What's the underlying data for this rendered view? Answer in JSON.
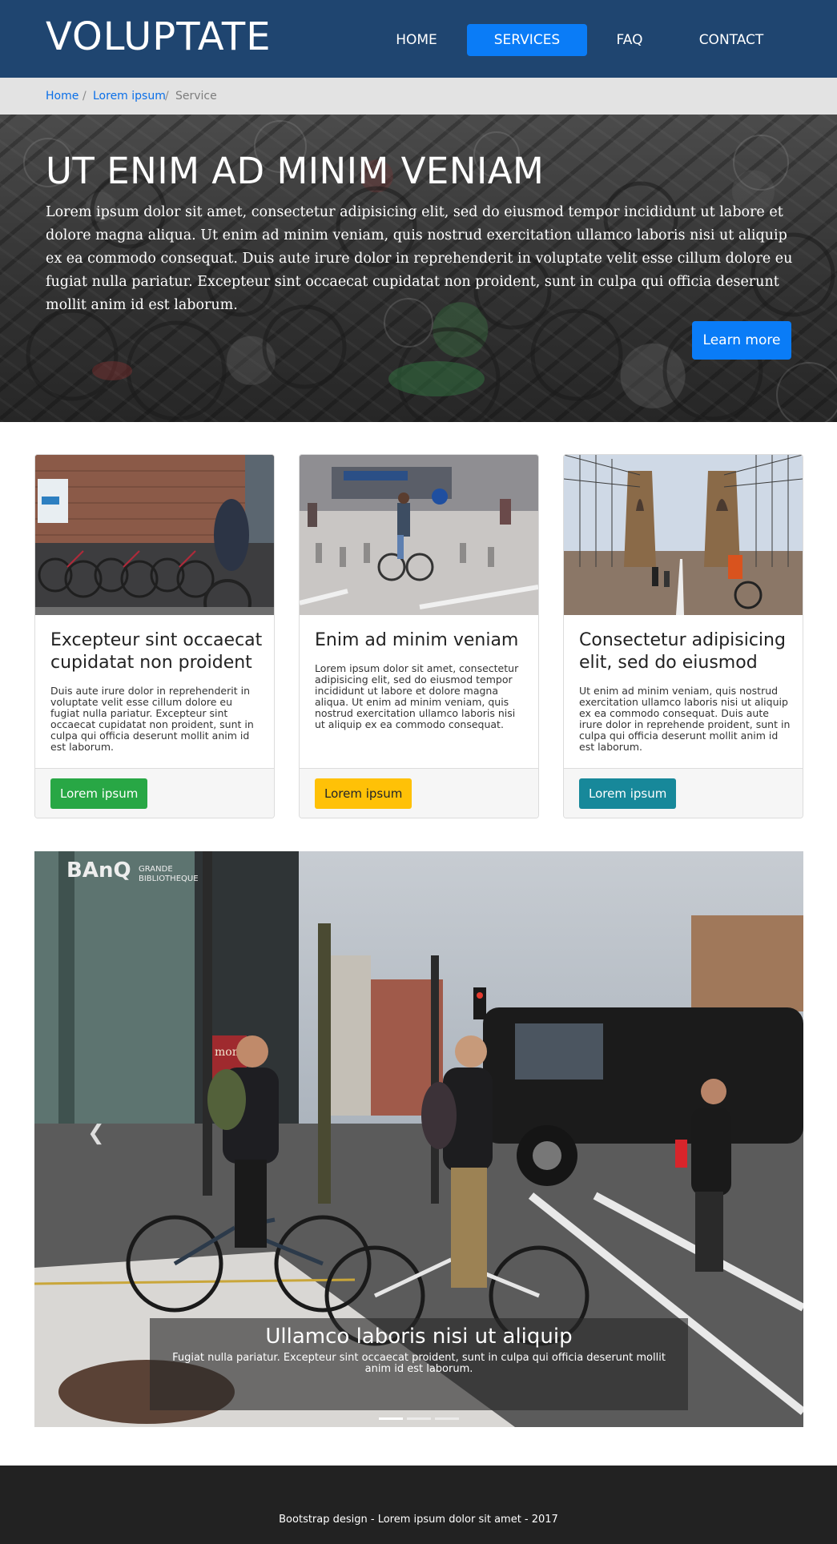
{
  "navbar": {
    "brand": "VOLUPTATE",
    "links": [
      {
        "label": "HOME"
      },
      {
        "label": "SERVICES",
        "active": true
      },
      {
        "label": "FAQ"
      },
      {
        "label": "CONTACT"
      }
    ]
  },
  "breadcrumb": {
    "items": [
      {
        "label": "Home"
      },
      {
        "label": "Lorem ipsum"
      },
      {
        "label": "Service"
      }
    ],
    "separator": "/"
  },
  "hero": {
    "title": "UT ENIM AD MINIM VENIAM",
    "text": "Lorem ipsum dolor sit amet, consectetur adipisicing elit, sed do eiusmod tempor incididunt ut labore et dolore magna aliqua. Ut enim ad minim veniam, quis nostrud exercitation ullamco laboris nisi ut aliquip ex ea commodo consequat. Duis aute irure dolor in reprehenderit in voluptate velit esse cillum dolore eu fugiat nulla pariatur. Excepteur sint occaecat cupidatat non proident, sunt in culpa qui officia deserunt mollit anim id est laborum.",
    "button": "Learn more"
  },
  "cards": [
    {
      "title": "Excepteur sint occaecat cupidatat non proident",
      "text": "Duis aute irure dolor in reprehenderit in voluptate velit esse cillum dolore eu fugiat nulla pariatur. Excepteur sint occaecat cupidatat non proident, sunt in culpa qui officia deserunt mollit anim id est laborum.",
      "button": "Lorem ipsum",
      "button_color": "#28a745"
    },
    {
      "title": "Enim ad minim veniam",
      "text": "Lorem ipsum dolor sit amet, consectetur adipisicing elit, sed do eiusmod tempor incididunt ut labore et dolore magna aliqua. Ut enim ad minim veniam, quis nostrud exercitation ullamco laboris nisi ut aliquip ex ea commodo consequat.",
      "button": "Lorem ipsum",
      "button_color": "#ffc107"
    },
    {
      "title": "Consectetur adipisicing elit, sed do eiusmod",
      "text": "Ut enim ad minim veniam, quis nostrud exercitation ullamco laboris nisi ut aliquip ex ea commodo consequat. Duis aute irure dolor in reprehende proident, sunt in culpa qui officia deserunt mollit anim id est laborum.",
      "button": "Lorem ipsum",
      "button_color": "#17889a"
    }
  ],
  "carousel": {
    "caption_title": "Ullamco laboris nisi ut aliquip",
    "caption_text": "Fugiat nulla pariatur. Excepteur sint occaecat proident, sunt in culpa qui officia deserunt mollit anim id est laborum.",
    "prev_icon": "chevron-left-icon",
    "slide_count": 3,
    "active_slide": 1,
    "signs": {
      "brand": "BAnQ",
      "line1": "GRANDE",
      "line2": "BIBLIOTHEQUE",
      "shop": "mon"
    }
  },
  "footer": {
    "text": "Bootstrap design - Lorem ipsum dolor sit amet - 2017"
  },
  "colors": {
    "navbar": "#1f4570",
    "primary": "#0a7cf7",
    "footer": "#222222"
  }
}
